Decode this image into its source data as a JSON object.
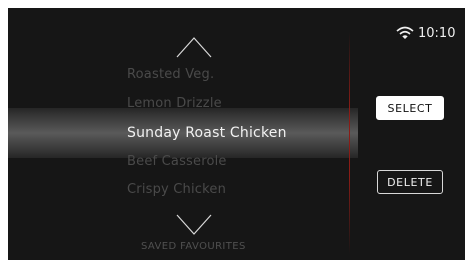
{
  "status_bar": {
    "time": "10:10",
    "wifi_icon": "wifi-icon"
  },
  "menu": {
    "items": [
      {
        "label": "Roasted Veg."
      },
      {
        "label": "Lemon Drizzle"
      },
      {
        "label": "Sunday Roast Chicken"
      },
      {
        "label": "Beef Casserole"
      },
      {
        "label": "Crispy Chicken"
      }
    ],
    "selected_index": 2,
    "footer": "SAVED FAVOURITES"
  },
  "actions": {
    "select_label": "SELECT",
    "delete_label": "DELETE"
  },
  "colors": {
    "background": "#161616",
    "accent_divider": "#8a1c16",
    "text_selected": "#f2f2f2",
    "text_dim": "#4a4a4a"
  }
}
